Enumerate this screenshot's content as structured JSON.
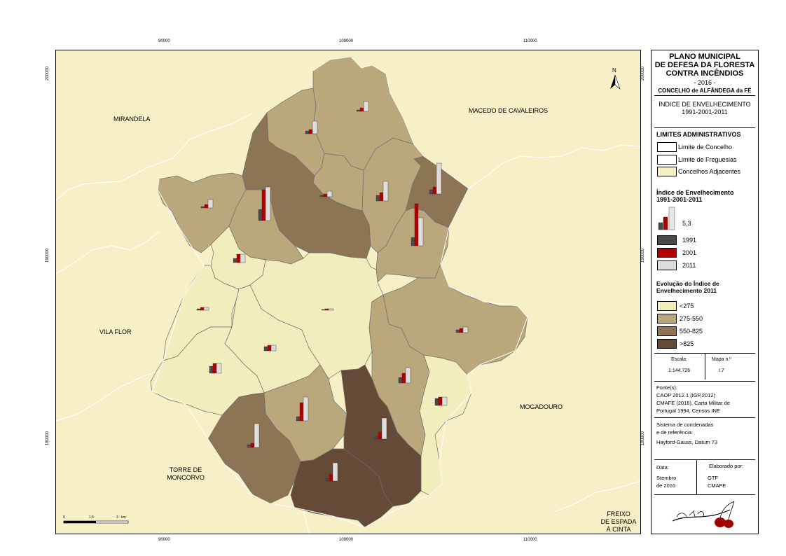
{
  "grid": {
    "x_ticks": [
      "90000",
      "100000",
      "110000"
    ],
    "y_ticks": [
      "200000",
      "190000",
      "180000"
    ]
  },
  "map": {
    "north": "N",
    "neighbors": {
      "mirandela": "MIRANDELA",
      "macedo": "MACEDO DE CAVALEIROS",
      "vila_flor": "VILA FLOR",
      "mogadouro": "MOGADOURO",
      "torre_1": "TORRE DE",
      "torre_2": "MONCORVO",
      "freixo_1": "FREIXO",
      "freixo_2": "DE ESPADA",
      "freixo_3": "À CINTA"
    },
    "scalebar": {
      "t0": "0",
      "t1": "1,5",
      "t2": "3",
      "unit": "km"
    }
  },
  "legend": {
    "title_1": "PLANO MUNICIPAL",
    "title_2": "DE DEFESA DA FLORESTA",
    "title_3": "CONTRA INCÊNDIOS",
    "year": "- 2016 -",
    "county": "CONCELHO de ALFÂNDEGA da FÉ",
    "map_title_1": "ÍNDICE DE ENVELHECIMENTO",
    "map_title_2": "1991-2001-2011",
    "admin_heading": "LIMITES ADMINISTRATIVOS",
    "admin_items": [
      "Limite de Concelho",
      "Limite de Freguesias",
      "Concelhos Adjacentes"
    ],
    "chart_heading_1": "Índice de Envelhecimento",
    "chart_heading_2": "1991-2001-2011",
    "chart_value": "5,3",
    "chart_years": [
      "1991",
      "2001",
      "2011"
    ],
    "evolution_heading_1": "Evolução do Índice de",
    "evolution_heading_2": "Envelhecimento 2011",
    "classes": [
      "<275",
      "275-550",
      "550-825",
      ">825"
    ],
    "scale_label": "Escala:",
    "scale_value": "1:144.726",
    "map_no_label": "Mapa n.º",
    "map_no_value": "I.7",
    "sources_label": "Fonte(s):",
    "sources_1": "CAOP 2012.1 (IGP,2012)",
    "sources_2": "CMAFE (2016), Carta Militar de",
    "sources_3": "Portugal 1994, Censos INE",
    "crs_label_1": "Sistema de corrdenadas",
    "crs_label_2": "e de referência:",
    "crs_value": "Hayford-Gauss, Datum 73",
    "date_label": "Data:",
    "date_value_1": "Stembro",
    "date_value_2": "de 2016",
    "author_label": "Elaborado por:",
    "author_value_1": "GTF",
    "author_value_2": "CMAFE"
  },
  "colors": {
    "class1": "#f2edbd",
    "class2": "#bba77c",
    "class3": "#8d7455",
    "class4": "#654a37",
    "adjacent": "#f7f0c6",
    "bar1991": "#4a4a4a",
    "bar2001": "#b00000",
    "bar2011": "#dddddd"
  }
}
